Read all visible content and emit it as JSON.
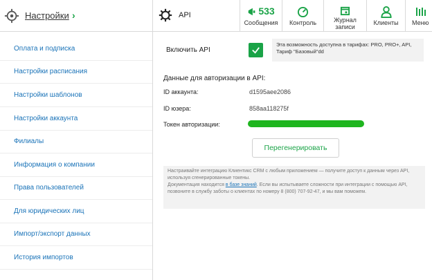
{
  "header": {
    "settings_title": "Настройки",
    "section_title": "API",
    "nav": [
      {
        "label": "Сообщения",
        "count": "533",
        "icon": "megaphone-icon"
      },
      {
        "label": "Контроль",
        "icon": "speedometer-icon"
      },
      {
        "label_line1": "Журнал",
        "label_line2": "записи",
        "icon": "calendar-icon"
      },
      {
        "label": "Клиенты",
        "icon": "user-icon"
      },
      {
        "label": "Меню",
        "icon": "menu-icon"
      }
    ],
    "accent_color": "#1aa347"
  },
  "sidebar": {
    "items": [
      {
        "label": "Оплата и подписка"
      },
      {
        "label": "Настройки расписания"
      },
      {
        "label": "Настройки шаблонов"
      },
      {
        "label": "Настройки аккаунта"
      },
      {
        "label": "Филиалы"
      },
      {
        "label": "Информация о компании"
      },
      {
        "label": "Права пользователей"
      },
      {
        "label": "Для юридических лиц"
      },
      {
        "label": "Импорт/экспорт данных"
      },
      {
        "label": "История импортов"
      }
    ]
  },
  "main": {
    "enable_label": "Включить API",
    "enabled": true,
    "availability_note": "Эта возможность доступна в тарифах: PRO, PRO+, API, Тариф \"Базовый\"dd",
    "auth_heading": "Данные для авторизации в API:",
    "account_id_label": "ID аккаунта:",
    "account_id_value": "d1595aee2086",
    "user_id_label": "ID юзера:",
    "user_id_value": "858aa118275f",
    "token_label": "Токен авторизации:",
    "regenerate_button": "Перегенерировать",
    "info_text_1": "Настраивайте интеграцию Клиентикс CRM с любым приложением — получите доступ к данным через API, используя сгенерированные токены.",
    "info_text_2a": "Документация находится",
    "info_link": "в базе знаний",
    "info_text_2b": ". Если вы испытываете сложности при интеграции с помощью API, позвоните в службу заботы о клиентах по номеру 8 (800) 707-92-47, и мы вам поможем."
  }
}
